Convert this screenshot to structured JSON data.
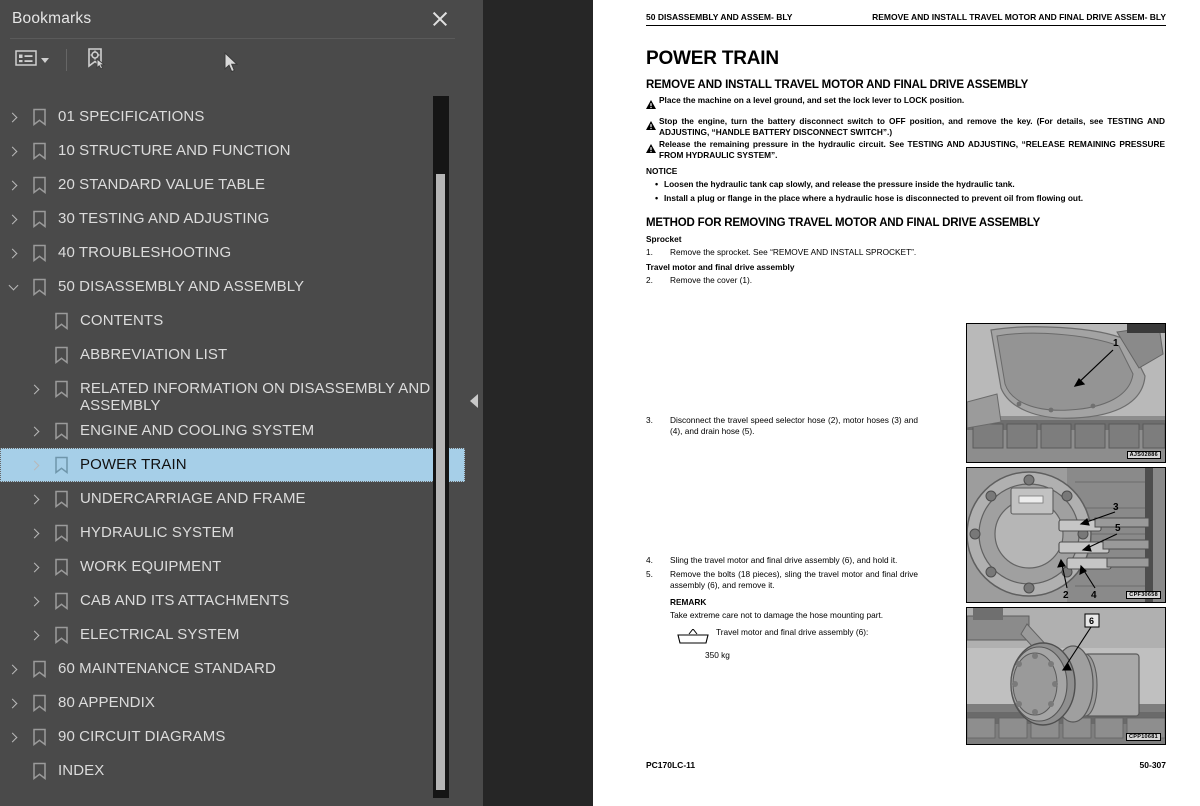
{
  "sidebar": {
    "title": "Bookmarks",
    "close_icon": "close-icon",
    "toolbar": {
      "list_options_icon": "list-options-icon",
      "dropdown_caret_icon": "chevron-down-icon",
      "find_bookmark_icon": "locate-bookmark-icon"
    },
    "items": [
      {
        "label": "01 SPECIFICATIONS",
        "level": 1,
        "state": "collapsed",
        "selected": false
      },
      {
        "label": "10 STRUCTURE AND FUNCTION",
        "level": 1,
        "state": "collapsed",
        "selected": false
      },
      {
        "label": "20 STANDARD VALUE TABLE",
        "level": 1,
        "state": "collapsed",
        "selected": false
      },
      {
        "label": "30 TESTING AND ADJUSTING",
        "level": 1,
        "state": "collapsed",
        "selected": false
      },
      {
        "label": "40 TROUBLESHOOTING",
        "level": 1,
        "state": "collapsed",
        "selected": false
      },
      {
        "label": "50 DISASSEMBLY AND ASSEMBLY",
        "level": 1,
        "state": "expanded",
        "selected": false
      },
      {
        "label": "CONTENTS",
        "level": 2,
        "state": "leaf",
        "selected": false
      },
      {
        "label": "ABBREVIATION LIST",
        "level": 2,
        "state": "leaf",
        "selected": false
      },
      {
        "label": "RELATED INFORMATION ON DISASSEMBLY AND ASSEMBLY",
        "level": 2,
        "state": "collapsed",
        "selected": false
      },
      {
        "label": "ENGINE AND COOLING SYSTEM",
        "level": 2,
        "state": "collapsed",
        "selected": false
      },
      {
        "label": "POWER TRAIN",
        "level": 2,
        "state": "collapsed",
        "selected": true
      },
      {
        "label": "UNDERCARRIAGE AND FRAME",
        "level": 2,
        "state": "collapsed",
        "selected": false
      },
      {
        "label": "HYDRAULIC SYSTEM",
        "level": 2,
        "state": "collapsed",
        "selected": false
      },
      {
        "label": "WORK EQUIPMENT",
        "level": 2,
        "state": "collapsed",
        "selected": false
      },
      {
        "label": "CAB AND ITS ATTACHMENTS",
        "level": 2,
        "state": "collapsed",
        "selected": false
      },
      {
        "label": "ELECTRICAL SYSTEM",
        "level": 2,
        "state": "collapsed",
        "selected": false
      },
      {
        "label": "60 MAINTENANCE STANDARD",
        "level": 1,
        "state": "collapsed",
        "selected": false
      },
      {
        "label": "80 APPENDIX",
        "level": 1,
        "state": "collapsed",
        "selected": false
      },
      {
        "label": "90 CIRCUIT DIAGRAMS",
        "level": 1,
        "state": "collapsed",
        "selected": false
      },
      {
        "label": "INDEX",
        "level": 1,
        "state": "leaf",
        "selected": false
      }
    ],
    "selection_color": "#a6cfe8"
  },
  "splitter": {
    "collapse_icon": "collapse-left-icon"
  },
  "document": {
    "running_header_left": "50 DISASSEMBLY AND ASSEM-\nBLY",
    "running_header_right": "REMOVE AND INSTALL TRAVEL MOTOR AND FINAL DRIVE ASSEM-\nBLY",
    "title": "POWER TRAIN",
    "section_title": "REMOVE AND INSTALL TRAVEL MOTOR AND FINAL DRIVE ASSEMBLY",
    "warnings": [
      "Place the machine on a level ground, and set the lock lever to LOCK position.",
      "Stop the engine, turn the battery disconnect switch to OFF position, and remove the key. (For details, see TESTING AND ADJUSTING, “HANDLE BATTERY DISCONNECT SWITCH”.)",
      "Release the remaining pressure in the hydraulic circuit. See TESTING AND ADJUSTING, “RELEASE REMAINING PRESSURE FROM HYDRAULIC SYSTEM”."
    ],
    "notice_heading": "NOTICE",
    "notice_items": [
      "Loosen the hydraulic tank cap slowly, and release the pressure inside the hydraulic tank.",
      "Install a plug or flange in the place where a hydraulic hose is disconnected to prevent oil from flowing out."
    ],
    "method_title": "METHOD FOR REMOVING TRAVEL MOTOR AND FINAL DRIVE ASSEMBLY",
    "subheading_sprocket": "Sprocket",
    "step1_num": "1.",
    "step1_text": "Remove the sprocket. See “REMOVE AND INSTALL SPROCKET”.",
    "subheading_assembly": "Travel motor and final drive assembly",
    "step2_num": "2.",
    "step2_text": "Remove the cover (1).",
    "step3_num": "3.",
    "step3_text": "Disconnect the travel speed selector hose (2), motor hoses (3) and (4), and drain hose (5).",
    "step4_num": "4.",
    "step4_text": "Sling the travel motor and final drive assembly (6), and hold it.",
    "step5_num": "5.",
    "step5_text": "Remove the bolts (18 pieces), sling the travel motor and final drive assembly (6), and remove it.",
    "remark_heading": "REMARK",
    "remark_text": "Take extreme care not to damage the hose mounting part.",
    "weight_label": "Travel motor and final drive assembly (6):",
    "weight_value": "350 kg",
    "photos": [
      {
        "name": "cover-photo",
        "code": "AJS02886",
        "callouts": [
          "1"
        ]
      },
      {
        "name": "travel-motor-hoses-photo",
        "code": "CPF30658",
        "callouts": [
          "2",
          "3",
          "4",
          "5"
        ]
      },
      {
        "name": "final-drive-assembly-photo",
        "code": "CPP10681",
        "callouts": [
          "6"
        ]
      }
    ],
    "footer_model": "PC170LC-11",
    "footer_page": "50-307"
  }
}
